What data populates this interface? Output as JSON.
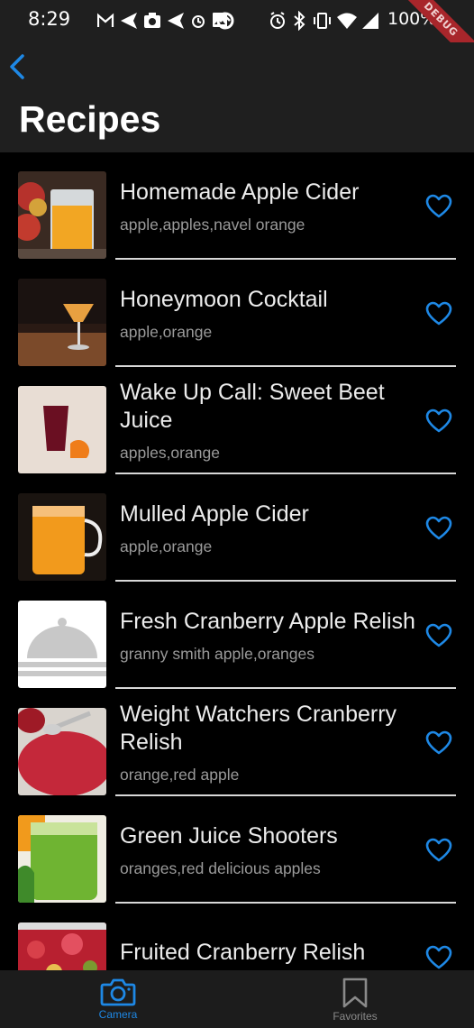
{
  "status_bar": {
    "time": "8:29",
    "battery": "100%",
    "left_icons": [
      "gmail-icon",
      "send-icon",
      "camera-app-icon",
      "send-icon",
      "alarm-icon",
      "image-icon",
      "circle-app-icon"
    ],
    "right_icons": [
      "alarm-icon",
      "bluetooth-icon",
      "vibrate-icon",
      "wifi-icon",
      "signal-icon"
    ]
  },
  "debug_banner": "DEBUG",
  "app_bar": {
    "title": "Recipes",
    "back_icon": "chevron-left-icon"
  },
  "colors": {
    "accent": "#1e88e5",
    "background": "#000000",
    "app_bar": "#1f1f1f",
    "divider": "#d8d8d8",
    "nav_inactive": "#8a8a8a"
  },
  "recipes": [
    {
      "title": "Homemade Apple Cider",
      "ingredients": "apple,apples,navel orange",
      "favorited": false
    },
    {
      "title": "Honeymoon Cocktail",
      "ingredients": "apple,orange",
      "favorited": false
    },
    {
      "title": "Wake Up Call: Sweet Beet Juice",
      "ingredients": "apples,orange",
      "favorited": false
    },
    {
      "title": "Mulled Apple Cider",
      "ingredients": "apple,orange",
      "favorited": false
    },
    {
      "title": "Fresh Cranberry Apple Relish",
      "ingredients": "granny smith apple,oranges",
      "favorited": false
    },
    {
      "title": "Weight Watchers Cranberry Relish",
      "ingredients": "orange,red apple",
      "favorited": false
    },
    {
      "title": "Green Juice Shooters",
      "ingredients": "oranges,red delicious apples",
      "favorited": false
    },
    {
      "title": "Fruited Cranberry Relish",
      "ingredients": "",
      "favorited": false
    }
  ],
  "bottom_nav": {
    "items": [
      {
        "label": "Camera",
        "icon": "camera-icon",
        "selected": true
      },
      {
        "label": "Favorites",
        "icon": "bookmark-icon",
        "selected": false
      }
    ]
  }
}
